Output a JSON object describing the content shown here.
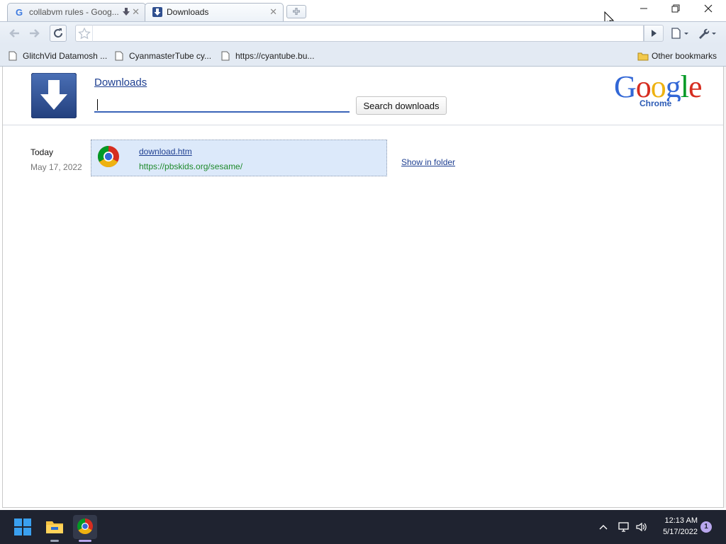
{
  "browser": {
    "tabs": [
      {
        "title": "collabvm rules - Goog...",
        "favicon": "google-g-icon",
        "active": false
      },
      {
        "title": "Downloads",
        "favicon": "downloads-icon",
        "active": true
      }
    ],
    "omnibox": {
      "value": ""
    },
    "bookmarks": [
      {
        "label": "GlitchVid Datamosh ...",
        "icon": "page-icon"
      },
      {
        "label": "CyanmasterTube cy...",
        "icon": "page-icon"
      },
      {
        "label": "https://cyantube.bu...",
        "icon": "page-icon"
      }
    ],
    "other_bookmarks": {
      "label": "Other bookmarks",
      "icon": "folder-icon"
    }
  },
  "page": {
    "title": "Downloads",
    "search": {
      "value": "",
      "button_label": "Search downloads"
    },
    "brand": {
      "logo_letters": [
        "G",
        "o",
        "o",
        "g",
        "l",
        "e"
      ],
      "product": "Chrome"
    },
    "groups": [
      {
        "day": "Today",
        "date": "May 17, 2022",
        "items": [
          {
            "file": "download.htm",
            "url": "https://pbskids.org/sesame/",
            "action": "Show in folder"
          }
        ]
      }
    ]
  },
  "taskbar": {
    "apps": [
      "windows-start-icon",
      "file-explorer-icon",
      "chrome-icon"
    ],
    "tray": {
      "time": "12:13 AM",
      "date": "5/17/2022",
      "notifications": "1"
    }
  },
  "colors": {
    "link": "#1e3f91",
    "url_green": "#1f8a2c",
    "item_highlight": "#dce9fa",
    "taskbar": "#1f2330",
    "google_blue": "#3267d6",
    "google_red": "#d62d20",
    "google_yellow": "#eeb211",
    "google_green": "#009925"
  }
}
